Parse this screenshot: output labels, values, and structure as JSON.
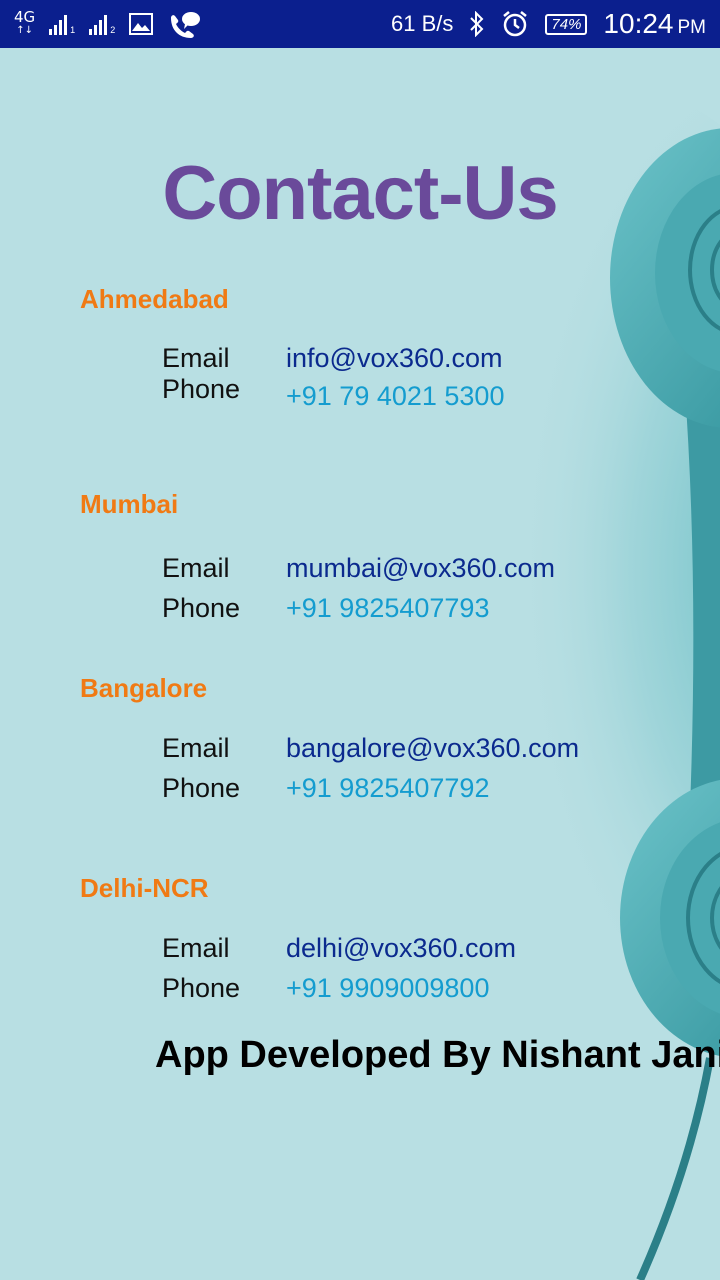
{
  "status_bar": {
    "network": "4G",
    "sim1": "1",
    "sim2": "2",
    "speed": "61 B/s",
    "battery": "74%",
    "time": "10:24",
    "ampm": "PM"
  },
  "title": "Contact-Us",
  "labels": {
    "email": "Email",
    "phone": "Phone"
  },
  "offices": [
    {
      "city": "Ahmedabad",
      "email": "info@vox360.com",
      "phone": "+91 79 4021 5300"
    },
    {
      "city": "Mumbai",
      "email": "mumbai@vox360.com",
      "phone": "+91 9825407793"
    },
    {
      "city": "Bangalore",
      "email": "bangalore@vox360.com",
      "phone": "+91 9825407792"
    },
    {
      "city": "Delhi-NCR",
      "email": "delhi@vox360.com",
      "phone": "+91 9909009800"
    }
  ],
  "footer": "App Developed By Nishant Jani",
  "colors": {
    "status_bar": "#0b1f8e",
    "background": "#b6dde1",
    "title": "#6a4a9a",
    "city": "#f07a14",
    "email": "#0b2a8e",
    "phone": "#149ccf"
  }
}
